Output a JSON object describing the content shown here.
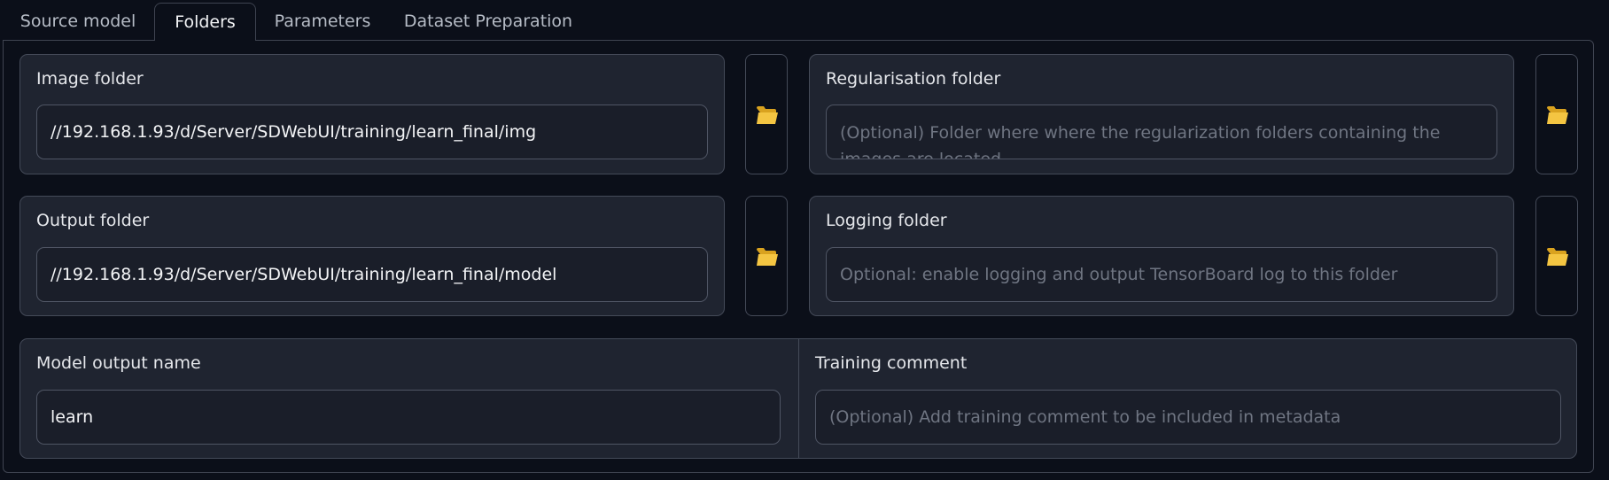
{
  "tabs": [
    {
      "label": "Source model",
      "active": false
    },
    {
      "label": "Folders",
      "active": true
    },
    {
      "label": "Parameters",
      "active": false
    },
    {
      "label": "Dataset Preparation",
      "active": false
    }
  ],
  "fields": {
    "image_folder": {
      "label": "Image folder",
      "value": "//192.168.1.93/d/Server/SDWebUI/training/learn_final/img",
      "placeholder": ""
    },
    "regularisation_folder": {
      "label": "Regularisation folder",
      "value": "",
      "placeholder": "(Optional) Folder where where the regularization folders containing the images are located"
    },
    "output_folder": {
      "label": "Output folder",
      "value": "//192.168.1.93/d/Server/SDWebUI/training/learn_final/model",
      "placeholder": ""
    },
    "logging_folder": {
      "label": "Logging folder",
      "value": "",
      "placeholder": "Optional: enable logging and output TensorBoard log to this folder"
    },
    "model_output_name": {
      "label": "Model output name",
      "value": "learn",
      "placeholder": ""
    },
    "training_comment": {
      "label": "Training comment",
      "value": "",
      "placeholder": "(Optional) Add training comment to be included in metadata"
    }
  },
  "icons": {
    "folder_button": "open-folder-icon",
    "folder_color": "#f4c542"
  },
  "colors": {
    "background": "#0b0f19",
    "panel": "#1f2430",
    "border": "#444a58",
    "text": "#e5e7eb",
    "placeholder": "#6f7582"
  }
}
